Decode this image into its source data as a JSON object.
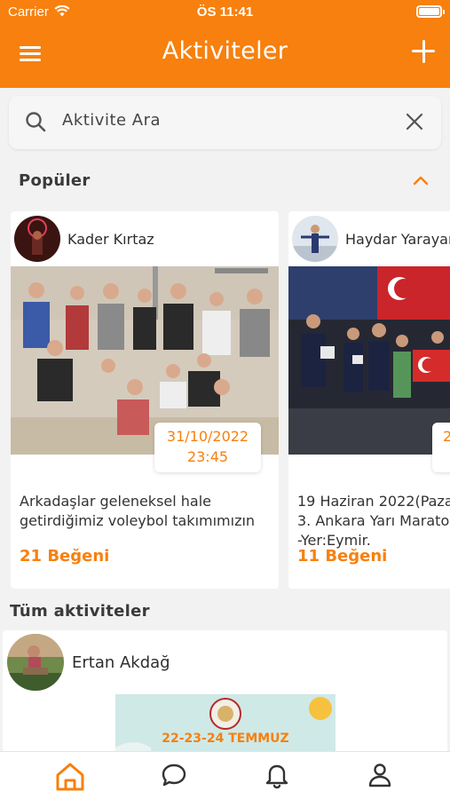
{
  "status_bar": {
    "carrier": "Carrier",
    "time": "ÖS 11:41"
  },
  "header": {
    "title": "Aktiviteler"
  },
  "search": {
    "placeholder": "Aktivite Ara"
  },
  "popular": {
    "title": "Popüler",
    "cards": [
      {
        "author": "Kader Kırtaz",
        "date": "31/10/2022",
        "time": "23:45",
        "desc_line1": "Arkadaşlar geleneksel hale",
        "desc_line2": "getirdiğimiz voleybol takımımızın",
        "likes": "21 Beğeni"
      },
      {
        "author": "Haydar Yarayan",
        "date": "2",
        "desc_line1": "19 Haziran 2022(Paza",
        "desc_line2": "3. Ankara Yarı Marato",
        "desc_line3": "-Yer:Eymir.",
        "likes": "11 Beğeni"
      }
    ]
  },
  "all_activities": {
    "title": "Tüm aktiviteler",
    "items": [
      {
        "author": "Ertan Akdağ",
        "poster_text": "22-23-24 TEMMUZ"
      }
    ]
  },
  "colors": {
    "accent": "#f7800e",
    "background": "#f2f2f2"
  },
  "tabbar": {
    "icons": [
      "home-icon",
      "chat-bubble-icon",
      "bell-icon",
      "profile-icon"
    ],
    "active": "home-icon"
  }
}
